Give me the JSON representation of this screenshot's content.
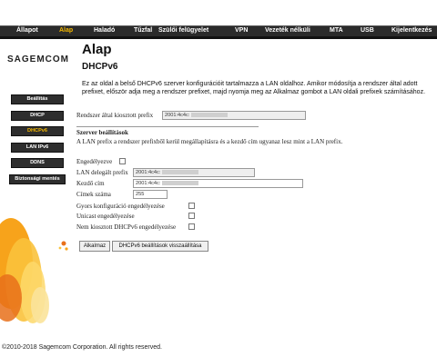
{
  "nav": {
    "items": [
      {
        "label": "Állapot",
        "active": false
      },
      {
        "label": "Alap",
        "active": true
      },
      {
        "label": "Haladó",
        "active": false
      },
      {
        "label": "Tűzfal",
        "active": false
      },
      {
        "label": "Szülői felügyelet",
        "active": false
      },
      {
        "label": "VPN",
        "active": false
      },
      {
        "label": "Vezeték nélküli",
        "active": false
      },
      {
        "label": "MTA",
        "active": false
      },
      {
        "label": "USB",
        "active": false
      },
      {
        "label": "Kijelentkezés",
        "active": false
      }
    ]
  },
  "logo": {
    "text": "Sagemcom"
  },
  "sidebar": {
    "items": [
      {
        "label": "Beállítás",
        "active": false
      },
      {
        "label": "DHCP",
        "active": false
      },
      {
        "label": "DHCPv6",
        "active": true
      },
      {
        "label": "LAN IPv6",
        "active": false
      },
      {
        "label": "DDNS",
        "active": false
      },
      {
        "label": "Biztonsági mentés",
        "active": false
      }
    ]
  },
  "page": {
    "title": "Alap",
    "subtitle": "DHCPv6",
    "intro": "Ez az oldal a belső DHCPv6 szerver konfigurációit tartalmazza a LAN oldalhoz. Amikor módosítja a rendszer által adott prefixet, először adja meg a rendszer prefixet, majd nyomja meg az Alkalmaz gombot a LAN oldali prefixek számításához."
  },
  "system_prefix": {
    "label": "Rendszer által kiosztott prefix",
    "value": "2001:4c4c:"
  },
  "server": {
    "heading": "Szerver beállítások",
    "description": "A LAN prefix a rendszer prefixből kerül megállapításra és a kezdő cím ugyanaz lesz mint a LAN prefix.",
    "enabled_label": "Engedélyezve",
    "enabled": false,
    "lan_prefix_label": "LAN delegált prefix",
    "lan_prefix_value": "2001:4c4c:",
    "start_label": "Kezdő cím",
    "start_value": "2001:4c4c:",
    "count_label": "Címek száma",
    "count_value": "255",
    "rapid_label": "Gyors konfiguráció engedélyezése",
    "unicast_label": "Unicast engedélyezése",
    "nonassigned_label": "Nem kiosztott DHCPv6 engedélyezése"
  },
  "buttons": {
    "apply": "Alkalmaz",
    "reset": "DHCPv6 beállítások visszaállítása"
  },
  "footer": {
    "copyright": "©2010-2018 Sagemcom Corporation. All rights reserved."
  },
  "colors": {
    "nav_bg": "#2b2b2b",
    "active": "#f5b800"
  }
}
